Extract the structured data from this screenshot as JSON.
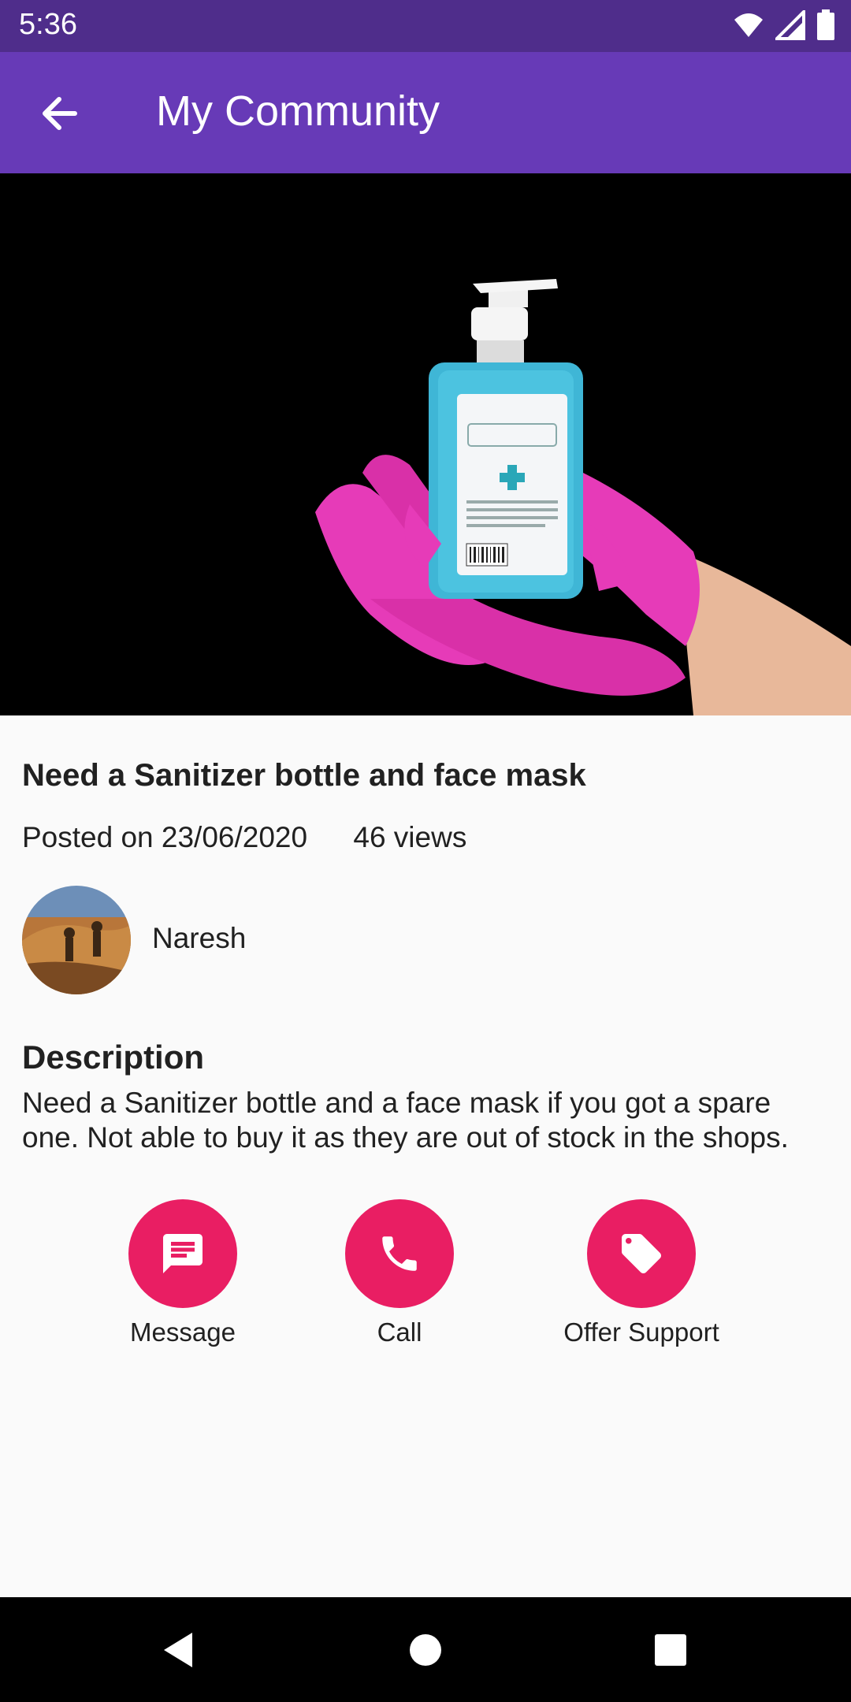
{
  "status_bar": {
    "time": "5:36",
    "icons": [
      "wifi-icon",
      "signal-icon",
      "battery-icon"
    ]
  },
  "app_bar": {
    "title": "My Community",
    "back_icon": "arrow-left-icon"
  },
  "post": {
    "title": "Need a Sanitizer bottle and face mask",
    "posted_on": "Posted on 23/06/2020",
    "views": "46 views",
    "author": "Naresh",
    "description_heading": "Description",
    "description": "Need a Sanitizer bottle and a face mask if you got a spare one. Not able to buy it as they are out of stock in the shops."
  },
  "actions": [
    {
      "label": "Message",
      "icon": "message-icon"
    },
    {
      "label": "Call",
      "icon": "phone-icon"
    },
    {
      "label": "Offer Support",
      "icon": "tag-icon"
    }
  ],
  "colors": {
    "status_bar": "#4f2d8b",
    "app_bar": "#673ab7",
    "accent": "#e91e63",
    "background": "#fafafa"
  },
  "nav_bar": {
    "icons": [
      "back-triangle-icon",
      "home-circle-icon",
      "recents-square-icon"
    ]
  }
}
